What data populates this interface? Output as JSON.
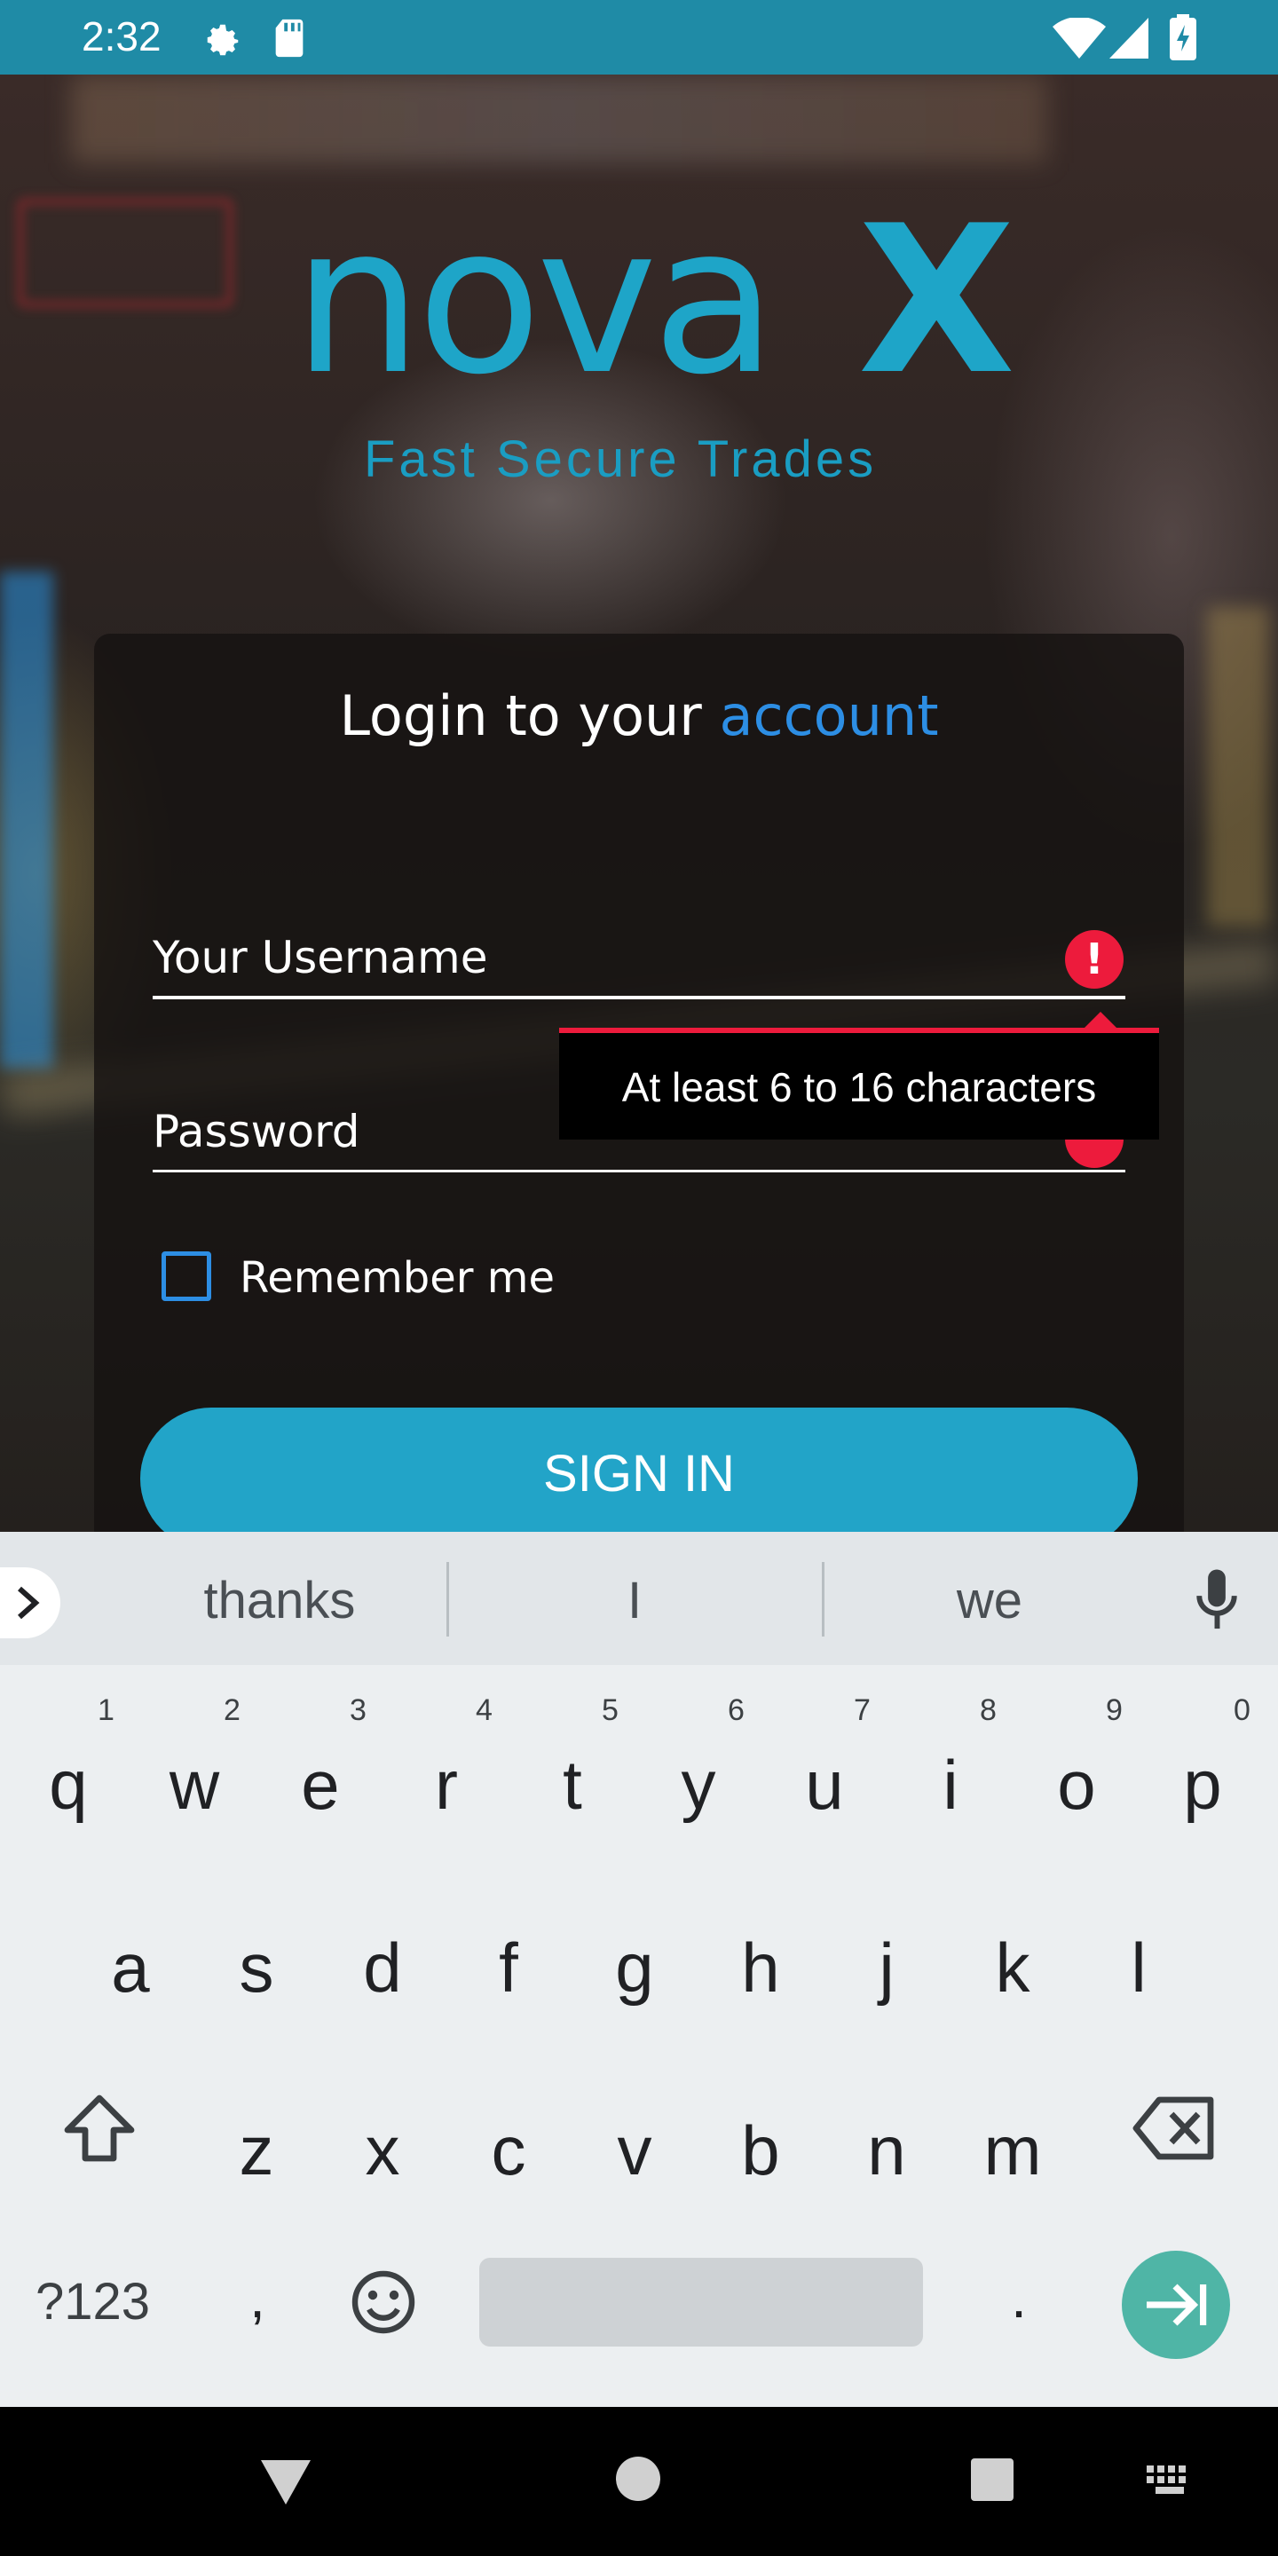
{
  "status_bar": {
    "time": "2:32"
  },
  "brand": {
    "name": "nova",
    "mark": "X",
    "tagline": "Fast Secure Trades"
  },
  "login": {
    "title_prefix": "Login to your ",
    "title_accent": "account",
    "username_label": "Your Username",
    "password_label": "Password",
    "error_icon": "!",
    "error_tooltip": "At least 6 to 16 characters",
    "remember_label": "Remember me",
    "sign_in_label": "SIGN IN"
  },
  "keyboard": {
    "suggestions": [
      "thanks",
      "I",
      "we"
    ],
    "row1": [
      "q",
      "w",
      "e",
      "r",
      "t",
      "y",
      "u",
      "i",
      "o",
      "p"
    ],
    "row1_hints": [
      "1",
      "2",
      "3",
      "4",
      "5",
      "6",
      "7",
      "8",
      "9",
      "0"
    ],
    "row2": [
      "a",
      "s",
      "d",
      "f",
      "g",
      "h",
      "j",
      "k",
      "l"
    ],
    "row3": [
      "z",
      "x",
      "c",
      "v",
      "b",
      "n",
      "m"
    ],
    "symbols_label": "?123",
    "comma": ",",
    "period": "."
  },
  "colors": {
    "accent": "#1ea5c8",
    "error": "#ed1b3c",
    "link": "#2d8ee4",
    "enter": "#4fb5a6"
  }
}
